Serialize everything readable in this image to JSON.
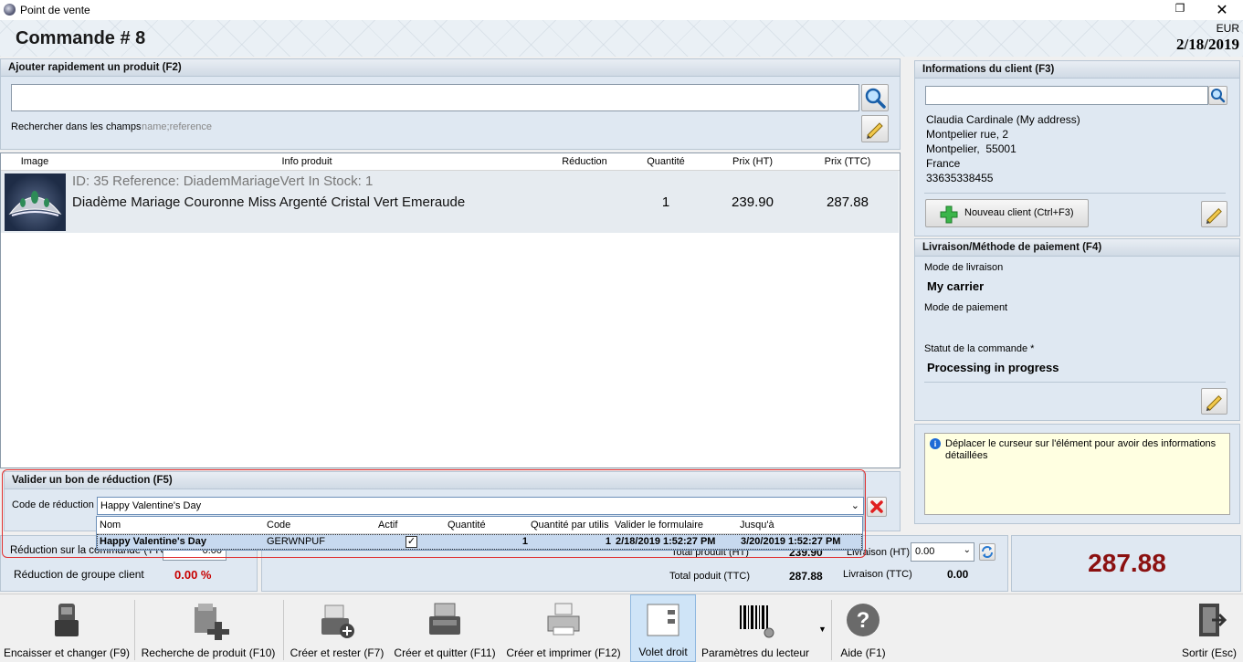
{
  "window": {
    "title": "Point de vente"
  },
  "header": {
    "order_title": "Commande # 8",
    "currency": "EUR",
    "date": "2/18/2019"
  },
  "quick_add": {
    "heading": "Ajouter rapidement un produit (F2)",
    "search_value": "",
    "search_fields_label": "Rechercher dans les champs",
    "search_fields_value": "name;reference"
  },
  "products_grid": {
    "columns": [
      "Image",
      "Info produit",
      "Réduction",
      "Quantité",
      "Prix (HT)",
      "Prix (TTC)"
    ],
    "rows": [
      {
        "meta": "ID: 35 Reference: DiademMariageVert In Stock: 1",
        "name": "Diadème Mariage Couronne Miss Argenté Cristal Vert Emeraude",
        "discount": "",
        "quantity": "1",
        "price_ht": "239.90",
        "price_ttc": "287.88"
      }
    ]
  },
  "voucher": {
    "heading": "Valider un bon de réduction (F5)",
    "code_label": "Code de réduction",
    "code_value": "Happy Valentine's Day",
    "dropdown_columns": [
      "Nom",
      "Code",
      "Actif",
      "Quantité",
      "Quantité par utilis",
      "Valider le formulaire",
      "Jusqu'à"
    ],
    "dropdown_row": {
      "name": "Happy Valentine's Day",
      "code": "GERWNPUF",
      "active": true,
      "quantity": "1",
      "qty_per_user": "1",
      "valid_from": "2/18/2019 1:52:27 PM",
      "valid_to": "3/20/2019 1:52:27 PM"
    }
  },
  "totals": {
    "order_discount_label": "Réduction sur la commande (TTC)",
    "order_discount_value": "0.00",
    "group_discount_label": "Réduction de groupe client",
    "group_discount_value": "0.00 %",
    "total_product_ht_label": "Total produit (HT)",
    "total_product_ht_value": "239.90",
    "total_product_ttc_label": "Total poduit (TTC)",
    "total_product_ttc_value": "287.88",
    "shipping_ht_label": "Livraison (HT)",
    "shipping_ht_value": "0.00",
    "shipping_ttc_label": "Livraison (TTC)",
    "shipping_ttc_value": "0.00",
    "grand_total": "287.88"
  },
  "client": {
    "heading": "Informations du client (F3)",
    "search_value": "",
    "address_lines": [
      "Claudia Cardinale (My address)",
      "Montpelier rue, 2",
      "Montpelier,  55001",
      "France",
      "33635338455"
    ],
    "new_client_label": "Nouveau client (Ctrl+F3)"
  },
  "delivery": {
    "heading": "Livraison/Méthode de paiement (F4)",
    "carrier_label": "Mode de livraison",
    "carrier_value": "My carrier",
    "payment_label": "Mode de paiement",
    "payment_value": "",
    "status_label": "Statut de la commande *",
    "status_value": "Processing in progress"
  },
  "info_box": {
    "text": "Déplacer le curseur sur l'élément pour avoir des informations détaillées"
  },
  "toolbar": {
    "buttons": [
      "Encaisser et changer (F9)",
      "Recherche de produit (F10)",
      "Créer et rester (F7)",
      "Créer et quitter (F11)",
      "Créer et imprimer (F12)",
      "Volet droit",
      "Paramètres du lecteur",
      "Aide (F1)",
      "Sortir (Esc)"
    ]
  },
  "colors": {
    "accent_red": "#c80000",
    "panel_blue": "#dfe8f2",
    "highlight_outline": "#e03030",
    "info_yellow": "#ffffe1"
  },
  "icons": [
    "search-icon",
    "pencil-icon",
    "plus-icon",
    "info-icon",
    "delete-icon",
    "refresh-icon",
    "checkbox-icon",
    "chevron-down-icon"
  ]
}
